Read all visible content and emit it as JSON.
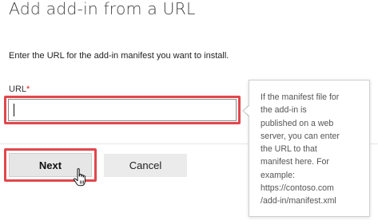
{
  "dialog": {
    "title": "Add add-in from a URL",
    "instructions": "Enter the URL for the add-in manifest you want to install.",
    "url_label": "URL",
    "required_marker": "*",
    "url_value": "",
    "url_placeholder": ""
  },
  "tooltip": {
    "lines": [
      "If the manifest file for",
      "the add-in is",
      "published on a web",
      "server, you can enter",
      "the URL to that",
      "manifest here. For",
      "example:",
      "https://contoso.com",
      "/add-in/manifest.xml"
    ]
  },
  "buttons": {
    "next_label": "Next",
    "cancel_label": "Cancel"
  },
  "colors": {
    "highlight": "#e0474c",
    "required": "#e02020",
    "button_bg": "#e6e6e6"
  },
  "icons": {
    "cursor": "hand-pointer-icon"
  }
}
